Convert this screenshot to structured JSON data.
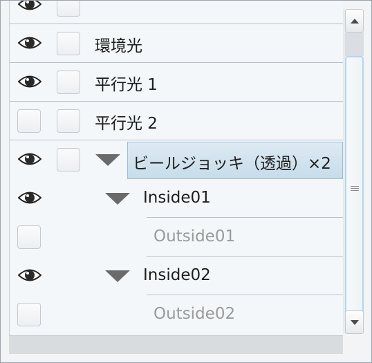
{
  "layers": [
    {
      "label": "環境光"
    },
    {
      "label": "平行光 1"
    },
    {
      "label": "平行光 2"
    },
    {
      "label": "ビールジョッキ（透過）×2"
    },
    {
      "label": "Inside01"
    },
    {
      "label": "Outside01"
    },
    {
      "label": "Inside02"
    },
    {
      "label": "Outside02"
    }
  ],
  "icons": {
    "visibility": "eye-icon",
    "expand": "triangle-down-icon",
    "scroll_up": "chevron-up-icon",
    "scroll_down": "chevron-down-icon"
  },
  "colors": {
    "selection": "#cfe2ef",
    "scroll_thumb_border": "#b6d5ec",
    "dimmed_text": "#9a9a9a"
  }
}
